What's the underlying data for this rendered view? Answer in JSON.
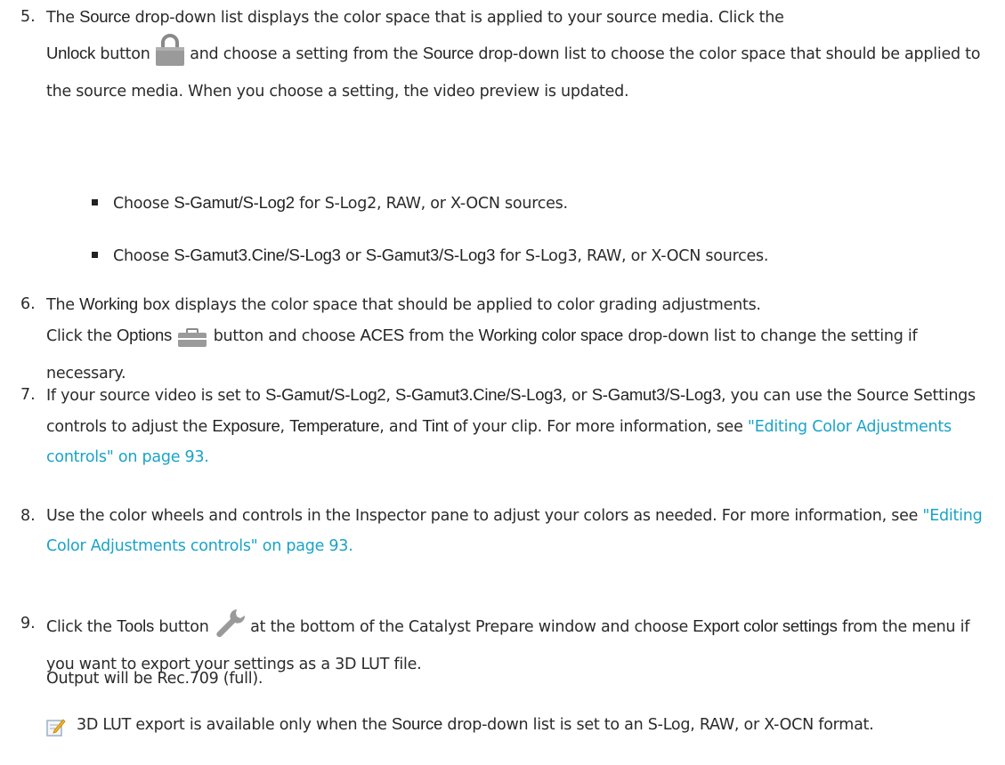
{
  "steps": [
    {
      "number": "5.",
      "t1": "The ",
      "b1": "Source",
      "t2": " drop-down list displays the color space that is applied to your source media. Click the",
      "b2": "Unlock",
      "t3": " button ",
      "t4": " and choose a setting from the ",
      "b3": "Source",
      "t5": " drop-down list to choose the color space that should be applied to the source media. When you choose a setting, the video preview is updated.",
      "icon": "padlock-icon"
    },
    {
      "number": "6.",
      "t1": "The ",
      "b1": "Working",
      "t2": "  box displays the color space that should be applied to color grading adjustments.",
      "t3": "Click the ",
      "b2": "Options",
      "t4": " button and choose ",
      "b3": "ACES",
      "t5": " from the ",
      "b4": "Working color space",
      "t6": " drop-down list to change the setting if necessary.",
      "icon": "toolbox-icon"
    },
    {
      "number": "7.",
      "t1": "If your source video is set to ",
      "b1": "S-Gamut/S-Log2",
      "t2": ", ",
      "b2": "S-Gamut3.Cine/S-Log3",
      "t3": ", or ",
      "b3": "S-Gamut3/S-Log3",
      "t4": ", you can use the Source Settings controls to adjust the ",
      "b4": "Exposure",
      "t5": ", ",
      "b5": "Temperature",
      "t6": ", and ",
      "b6": "Tint",
      "t7": " of your clip. For more information, see ",
      "link": "\"Editing Color Adjustments controls\" on page 93."
    },
    {
      "number": "8.",
      "t1": "Use the color wheels and controls in the Inspector pane to adjust your colors as needed. For more information, see ",
      "link": "\"Editing Color Adjustments controls\" on page 93."
    },
    {
      "number": "9.",
      "t1": "Click the ",
      "b1": "Tools",
      "t2": " button ",
      "t3": " at the bottom of the Catalyst Prepare window and choose ",
      "b2": "Export color settings",
      "t4": " from the menu if you want to export your settings as a 3D LUT file.",
      "icon": "wrench-icon"
    }
  ],
  "bullets": [
    {
      "t1": "Choose ",
      "b1": "S-Gamut/S-Log2",
      "t2": " for S-Log2, RAW, or X-OCN sources."
    },
    {
      "t1": "Choose ",
      "b1": "S-Gamut3.Cine/S-Log3",
      "t2": " or ",
      "b2": "S-Gamut3/S-Log3",
      "t3": " for S-Log3, RAW, or X-OCN sources."
    }
  ],
  "output_text": "Output will be Rec.709 (full).",
  "note": {
    "icon": "note-pencil-icon",
    "t1": "3D LUT export is available only when the ",
    "b1": "Source",
    "t2": " drop-down list is set to an S-Log, RAW, or X-OCN format."
  },
  "colors": {
    "text": "#2b2b2b",
    "link": "#1aa3c8"
  }
}
